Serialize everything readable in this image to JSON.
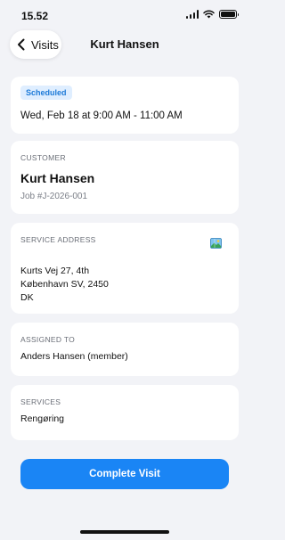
{
  "status_bar": {
    "time": "15.52",
    "battery_level": 1.0
  },
  "nav": {
    "back_label": "Visits",
    "title": "Kurt Hansen"
  },
  "schedule": {
    "status_badge": "Scheduled",
    "datetime": "Wed, Feb 18 at 9:00 AM - 11:00 AM"
  },
  "customer": {
    "label": "CUSTOMER",
    "name": "Kurt Hansen",
    "job_number": "Job #J-2026-001"
  },
  "service_address": {
    "label": "SERVICE ADDRESS",
    "map_icon": "map-icon",
    "line1": "Kurts Vej 27, 4th",
    "line2": "København SV, 2450",
    "line3": "DK"
  },
  "assigned": {
    "label": "ASSIGNED TO",
    "value": "Anders Hansen (member)"
  },
  "services": {
    "label": "SERVICES",
    "value": "Rengøring"
  },
  "actions": {
    "complete_label": "Complete Visit"
  },
  "colors": {
    "accent": "#1a85f5",
    "badge_bg": "#dfeeff",
    "badge_text": "#1d7ad8",
    "background": "#f2f3f7"
  }
}
